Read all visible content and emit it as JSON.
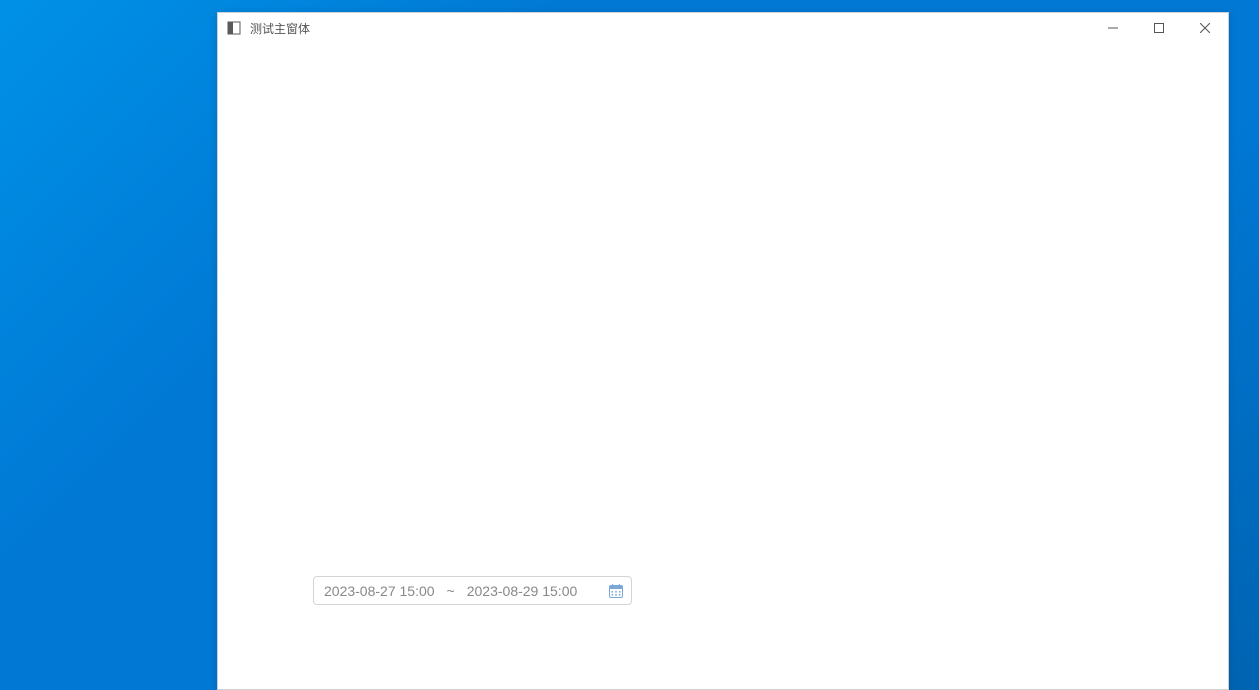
{
  "window": {
    "title": "测试主窗体"
  },
  "dateRange": {
    "start": "2023-08-27 15:00",
    "separator": "~",
    "end": "2023-08-29 15:00"
  }
}
